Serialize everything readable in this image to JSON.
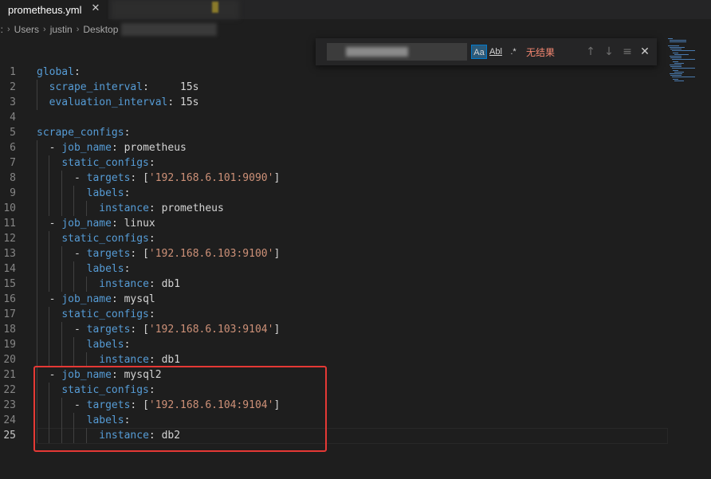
{
  "tab": {
    "filename": "prometheus.yml",
    "close": "✕"
  },
  "breadcrumb": [
    "C:",
    "Users",
    "justin",
    "Desktop"
  ],
  "find_widget": {
    "match_case": "Aa",
    "whole_word": "Abl",
    "regex": ".*",
    "status": "无结果",
    "prev": "↑",
    "next": "↓",
    "selection": "≡",
    "close": "✕"
  },
  "editor": {
    "active_line": 25,
    "lines": [
      {
        "n": "1",
        "key": "global",
        "after": ":",
        "value": ""
      },
      {
        "n": "2",
        "key": "  scrape_interval",
        "after": ":     ",
        "value": "15s"
      },
      {
        "n": "3",
        "key": "  evaluation_interval",
        "after": ": ",
        "value": "15s"
      },
      {
        "n": "4",
        "key": "",
        "after": "",
        "value": ""
      },
      {
        "n": "5",
        "key": "scrape_configs",
        "after": ":",
        "value": ""
      },
      {
        "n": "6",
        "key": "  - job_name",
        "after": ": ",
        "value": "prometheus"
      },
      {
        "n": "7",
        "key": "    static_configs",
        "after": ":",
        "value": ""
      },
      {
        "n": "8",
        "key": "      - targets",
        "after": ": ",
        "value": "['192.168.6.101:9090']"
      },
      {
        "n": "9",
        "key": "        labels",
        "after": ":",
        "value": ""
      },
      {
        "n": "10",
        "key": "          instance",
        "after": ": ",
        "value": "prometheus"
      },
      {
        "n": "11",
        "key": "  - job_name",
        "after": ": ",
        "value": "linux"
      },
      {
        "n": "12",
        "key": "    static_configs",
        "after": ":",
        "value": ""
      },
      {
        "n": "13",
        "key": "      - targets",
        "after": ": ",
        "value": "['192.168.6.103:9100']"
      },
      {
        "n": "14",
        "key": "        labels",
        "after": ":",
        "value": ""
      },
      {
        "n": "15",
        "key": "          instance",
        "after": ": ",
        "value": "db1"
      },
      {
        "n": "16",
        "key": "  - job_name",
        "after": ": ",
        "value": "mysql"
      },
      {
        "n": "17",
        "key": "    static_configs",
        "after": ":",
        "value": ""
      },
      {
        "n": "18",
        "key": "      - targets",
        "after": ": ",
        "value": "['192.168.6.103:9104']"
      },
      {
        "n": "19",
        "key": "        labels",
        "after": ":",
        "value": ""
      },
      {
        "n": "20",
        "key": "          instance",
        "after": ": ",
        "value": "db1"
      },
      {
        "n": "21",
        "key": "  - job_name",
        "after": ": ",
        "value": "mysql2"
      },
      {
        "n": "22",
        "key": "    static_configs",
        "after": ":",
        "value": ""
      },
      {
        "n": "23",
        "key": "      - targets",
        "after": ": ",
        "value": "['192.168.6.104:9104']"
      },
      {
        "n": "24",
        "key": "        labels",
        "after": ":",
        "value": ""
      },
      {
        "n": "25",
        "key": "          instance",
        "after": ": ",
        "value": "db2"
      }
    ]
  },
  "colors": {
    "key": "#569cd6",
    "value": "#ce9178",
    "highlight_border": "#e53935"
  }
}
